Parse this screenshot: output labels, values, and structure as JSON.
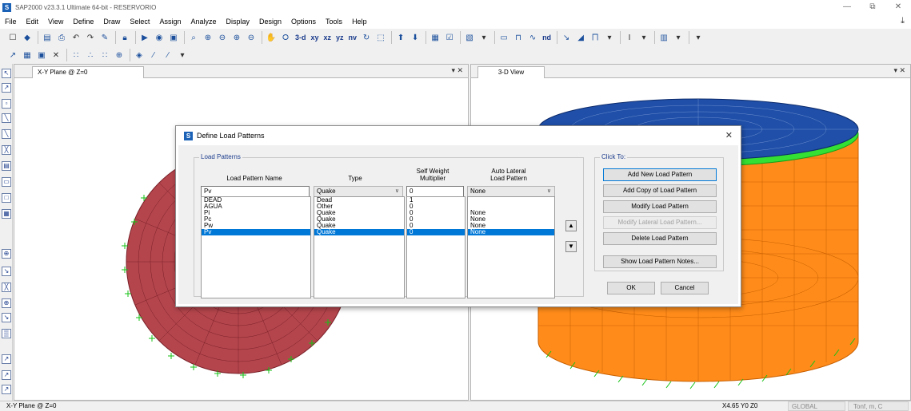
{
  "window": {
    "title": "SAP2000 v23.3.1 Ultimate 64-bit - RESERVORIO",
    "minimize": "—",
    "restore": "⧉",
    "close": "✕"
  },
  "menu": [
    "File",
    "Edit",
    "View",
    "Define",
    "Draw",
    "Select",
    "Assign",
    "Analyze",
    "Display",
    "Design",
    "Options",
    "Tools",
    "Help"
  ],
  "toolbar": {
    "view_labels": [
      "3-d",
      "xy",
      "xz",
      "yz",
      "nv"
    ],
    "nd_label": "nd"
  },
  "panels": {
    "left": {
      "tab": "X-Y Plane @ Z=0",
      "controls": "▾ ✕"
    },
    "right": {
      "tab": "3-D View",
      "controls": "▾ ✕"
    }
  },
  "colors": {
    "accent": "#0078d7",
    "tank_orange": "#ff8c1a",
    "tank_blue": "#1f4fa8",
    "tank_green": "#33e033",
    "plan_red": "#b4454d",
    "support_green": "#16c216"
  },
  "dialog": {
    "title": "Define Load Patterns",
    "close": "✕",
    "group_patterns": "Load Patterns",
    "group_click": "Click To:",
    "headers": {
      "name": "Load Pattern Name",
      "type": "Type",
      "self_weight_1": "Self Weight",
      "self_weight_2": "Multiplier",
      "auto_lateral_1": "Auto Lateral",
      "auto_lateral_2": "Load Pattern"
    },
    "inputs": {
      "name": "Pv",
      "type": "Quake",
      "multiplier": "0",
      "auto_lateral": "None"
    },
    "rows": [
      {
        "name": "DEAD",
        "type": "Dead",
        "mult": "1",
        "lateral": ""
      },
      {
        "name": "AGUA",
        "type": "Other",
        "mult": "0",
        "lateral": ""
      },
      {
        "name": "Pi",
        "type": "Quake",
        "mult": "0",
        "lateral": "None"
      },
      {
        "name": "Pc",
        "type": "Quake",
        "mult": "0",
        "lateral": "None"
      },
      {
        "name": "Pw",
        "type": "Quake",
        "mult": "0",
        "lateral": "None"
      },
      {
        "name": "Pv",
        "type": "Quake",
        "mult": "0",
        "lateral": "None"
      }
    ],
    "buttons": {
      "add": "Add New Load Pattern",
      "add_copy": "Add Copy of Load Pattern",
      "modify": "Modify Load Pattern",
      "modify_lateral": "Modify Lateral Load Pattern...",
      "delete": "Delete Load Pattern",
      "show_notes": "Show Load Pattern Notes...",
      "ok": "OK",
      "cancel": "Cancel",
      "move_up": "▲",
      "move_down": "▼"
    }
  },
  "status": {
    "left": "X-Y Plane @ Z=0",
    "coords": "X4.65  Y0  Z0",
    "coord_system": "GLOBAL",
    "units": "Tonf, m, C"
  }
}
